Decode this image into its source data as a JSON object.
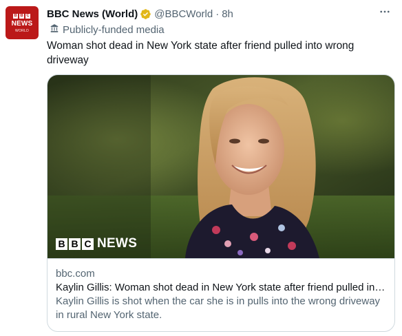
{
  "colors": {
    "brand_red": "#bb1919",
    "text_primary": "#0f1419",
    "text_secondary": "#536471",
    "border": "#cfd9de",
    "verified_gold": "#e2b719"
  },
  "author": {
    "avatar": {
      "letters": [
        "B",
        "B",
        "C"
      ],
      "word": "NEWS",
      "subword": "WORLD"
    },
    "name": "BBC News (World)",
    "verified_icon": "gold-verified-badge-icon",
    "handle": "@BBCWorld",
    "separator": "·",
    "time": "8h",
    "label_icon": "government-building-icon",
    "label": "Publicly-funded media"
  },
  "more_icon": "more-options-icon",
  "tweet": {
    "text": "Woman shot dead in New York state after friend pulled into wrong driveway"
  },
  "card": {
    "image_logo": {
      "letters": [
        "B",
        "B",
        "C"
      ],
      "word": "NEWS"
    },
    "domain": "bbc.com",
    "title": "Kaylin Gillis: Woman shot dead in New York state after friend pulled into wrong driveway",
    "description": "Kaylin Gillis is shot when the car she is in pulls into the wrong driveway in rural New York state."
  }
}
